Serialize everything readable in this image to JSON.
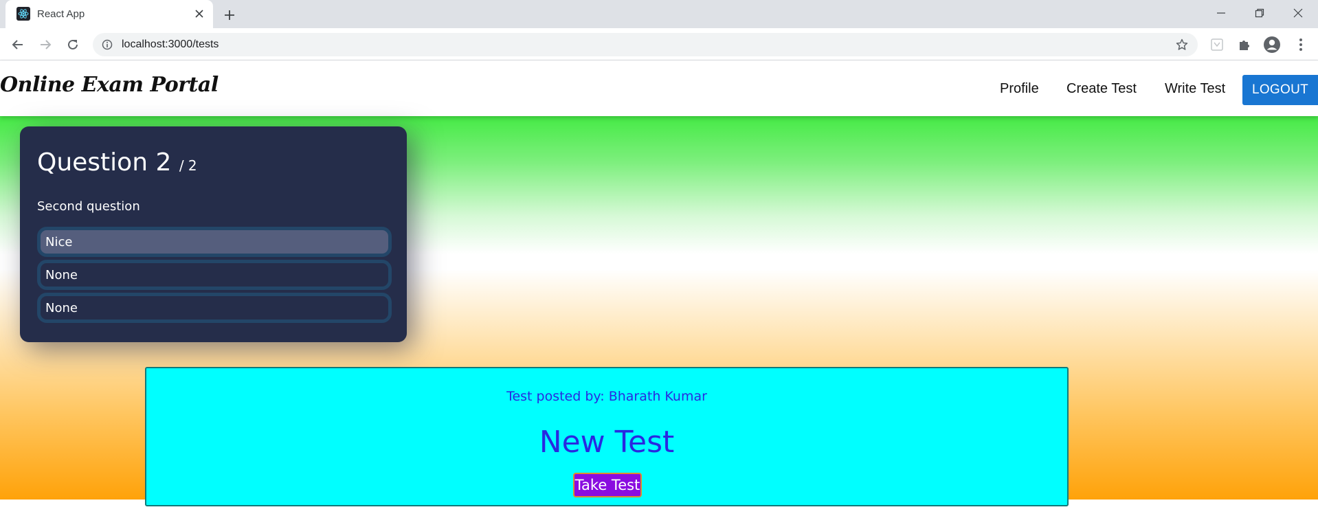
{
  "browser": {
    "tab_title": "React App",
    "url": "localhost:3000/tests"
  },
  "navbar": {
    "brand": "Online Exam Portal",
    "links": [
      "Profile",
      "Create Test",
      "Write Test"
    ],
    "logout_label": "LOGOUT"
  },
  "question_card": {
    "title_prefix": "Question 2",
    "total": "/ 2",
    "question_text": "Second question",
    "options": [
      {
        "label": "Nice",
        "selected": true
      },
      {
        "label": "None",
        "selected": false
      },
      {
        "label": "None",
        "selected": false
      }
    ]
  },
  "test_card": {
    "posted_by": "Test posted by: Bharath Kumar",
    "title": "New Test",
    "button_label": "Take Test"
  },
  "colors": {
    "logout_bg": "#1976d2",
    "card_bg": "#252d4a",
    "test_card_bg": "#00ffff",
    "test_text": "#2929e0",
    "take_test_bg": "#8a0ce0"
  },
  "icons": {
    "favicon": "react-icon",
    "tab_close": "close-icon",
    "new_tab": "plus-icon",
    "back": "arrow-left-icon",
    "forward": "arrow-right-icon",
    "reload": "reload-icon",
    "info": "info-icon",
    "bookmark": "star-icon",
    "extensions": "puzzle-icon",
    "profile": "account-icon",
    "menu": "kebab-menu-icon"
  }
}
